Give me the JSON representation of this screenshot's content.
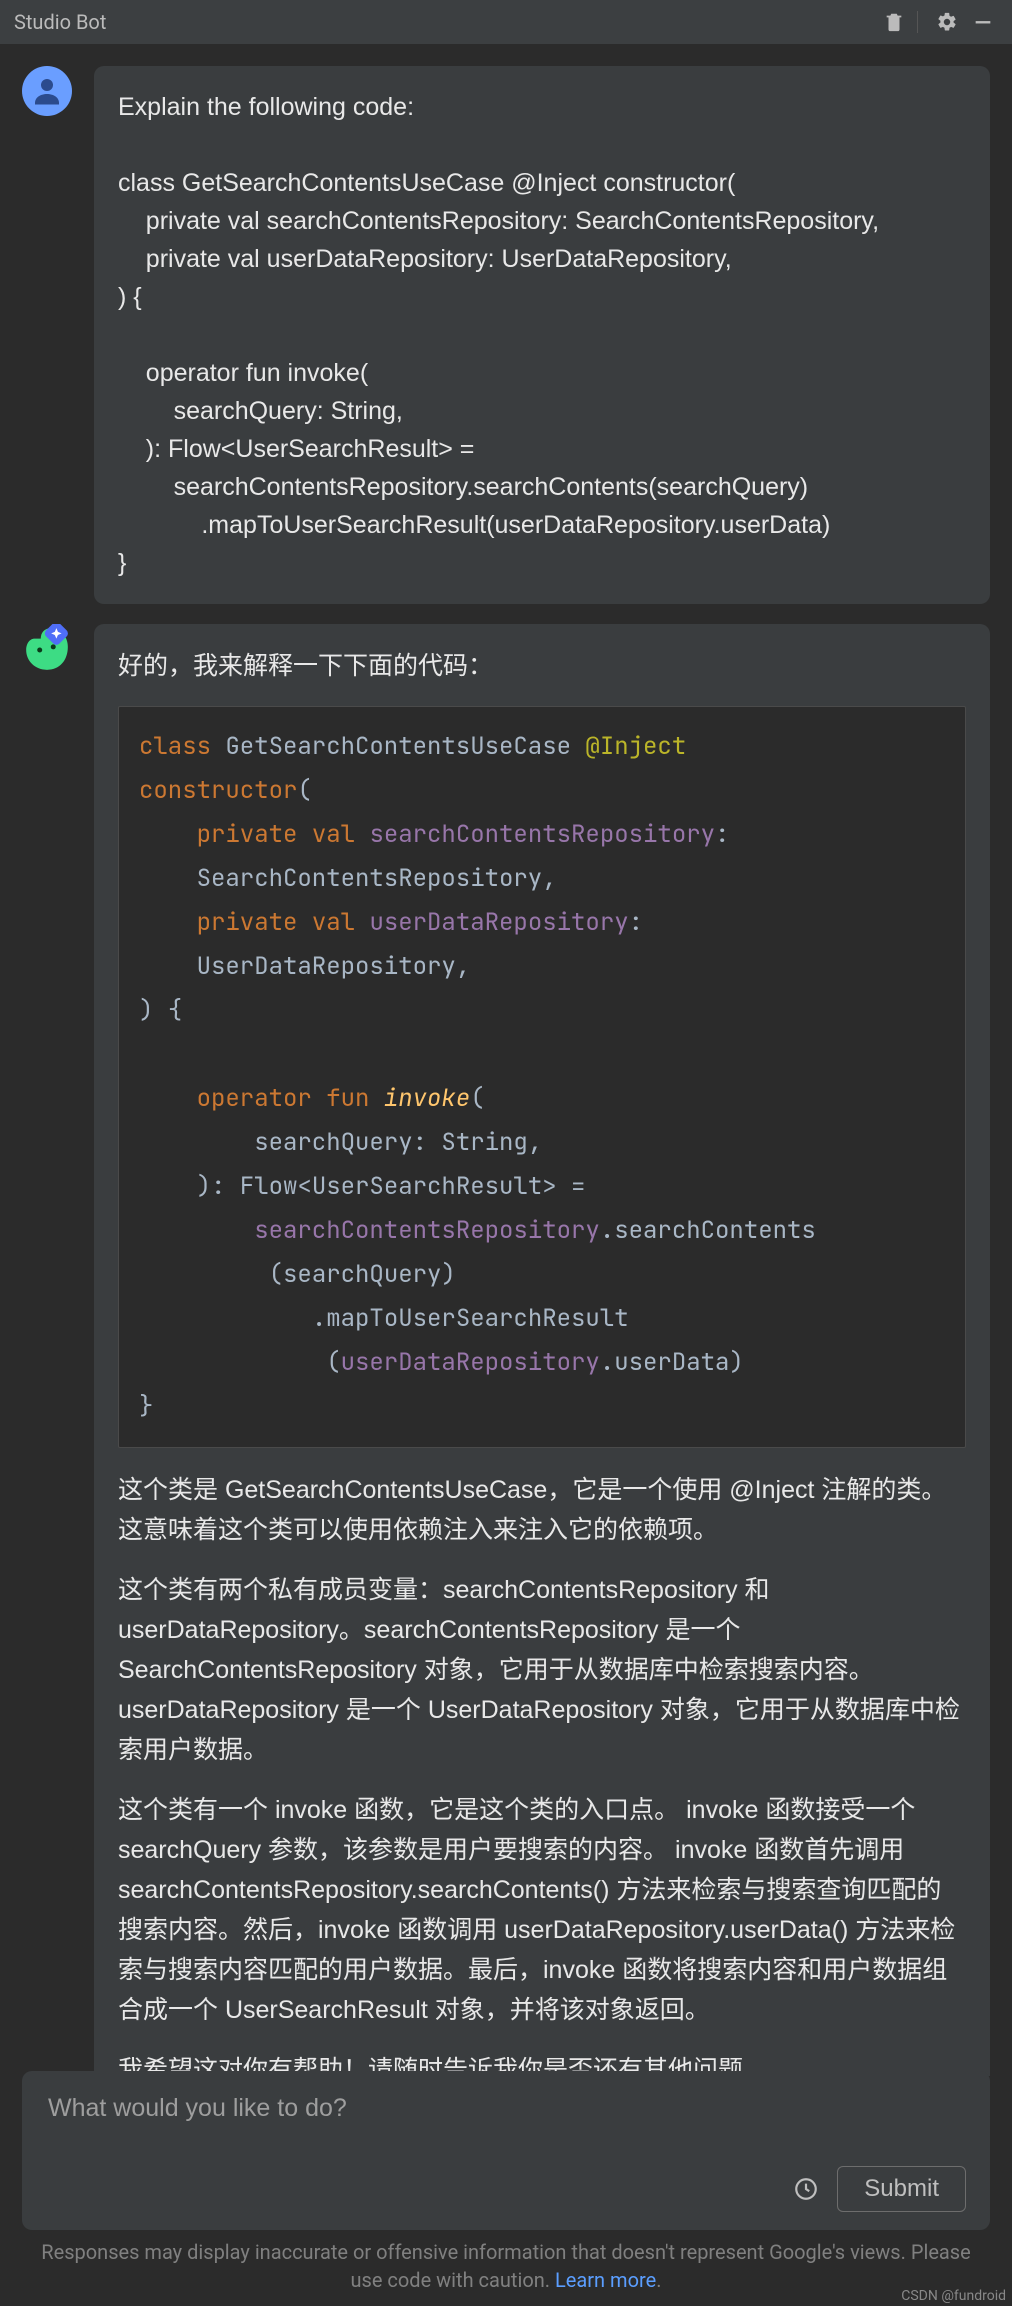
{
  "window": {
    "title": "Studio Bot"
  },
  "titlebar_icons": {
    "trash": "trash-icon",
    "gear": "gear-icon",
    "minimize": "minimize-icon"
  },
  "user_message": {
    "text": "Explain the following code:\n\nclass GetSearchContentsUseCase @Inject constructor(\n    private val searchContentsRepository: SearchContentsRepository,\n    private val userDataRepository: UserDataRepository,\n) {\n\n    operator fun invoke(\n        searchQuery: String,\n    ): Flow<UserSearchResult> =\n        searchContentsRepository.searchContents(searchQuery)\n            .mapToUserSearchResult(userDataRepository.userData)\n}"
  },
  "bot_message": {
    "intro": "好的，我来解释一下下面的代码：",
    "code_tokens": [
      {
        "t": "kw",
        "v": "class"
      },
      {
        "t": "sp",
        "v": " "
      },
      {
        "t": "type",
        "v": "GetSearchContentsUseCase"
      },
      {
        "t": "sp",
        "v": " "
      },
      {
        "t": "anno",
        "v": "@Inject"
      },
      {
        "t": "nl",
        "v": "\n"
      },
      {
        "t": "kw",
        "v": "constructor"
      },
      {
        "t": "punc",
        "v": "("
      },
      {
        "t": "nl",
        "v": "\n"
      },
      {
        "t": "sp",
        "v": "    "
      },
      {
        "t": "kw",
        "v": "private"
      },
      {
        "t": "sp",
        "v": " "
      },
      {
        "t": "kw",
        "v": "val"
      },
      {
        "t": "sp",
        "v": " "
      },
      {
        "t": "name",
        "v": "searchContentsRepository"
      },
      {
        "t": "punc",
        "v": ":"
      },
      {
        "t": "nl",
        "v": "\n"
      },
      {
        "t": "sp",
        "v": "    "
      },
      {
        "t": "type",
        "v": "SearchContentsRepository"
      },
      {
        "t": "punc",
        "v": ","
      },
      {
        "t": "nl",
        "v": "\n"
      },
      {
        "t": "sp",
        "v": "    "
      },
      {
        "t": "kw",
        "v": "private"
      },
      {
        "t": "sp",
        "v": " "
      },
      {
        "t": "kw",
        "v": "val"
      },
      {
        "t": "sp",
        "v": " "
      },
      {
        "t": "name",
        "v": "userDataRepository"
      },
      {
        "t": "punc",
        "v": ":"
      },
      {
        "t": "nl",
        "v": "\n"
      },
      {
        "t": "sp",
        "v": "    "
      },
      {
        "t": "type",
        "v": "UserDataRepository"
      },
      {
        "t": "punc",
        "v": ","
      },
      {
        "t": "nl",
        "v": "\n"
      },
      {
        "t": "punc",
        "v": ")"
      },
      {
        "t": "sp",
        "v": " "
      },
      {
        "t": "punc",
        "v": "{"
      },
      {
        "t": "nl",
        "v": "\n\n"
      },
      {
        "t": "sp",
        "v": "    "
      },
      {
        "t": "kw",
        "v": "operator"
      },
      {
        "t": "sp",
        "v": " "
      },
      {
        "t": "kw",
        "v": "fun"
      },
      {
        "t": "sp",
        "v": " "
      },
      {
        "t": "func",
        "v": "invoke"
      },
      {
        "t": "punc",
        "v": "("
      },
      {
        "t": "nl",
        "v": "\n"
      },
      {
        "t": "sp",
        "v": "        "
      },
      {
        "t": "type",
        "v": "searchQuery"
      },
      {
        "t": "punc",
        "v": ": "
      },
      {
        "t": "type",
        "v": "String"
      },
      {
        "t": "punc",
        "v": ","
      },
      {
        "t": "nl",
        "v": "\n"
      },
      {
        "t": "sp",
        "v": "    "
      },
      {
        "t": "punc",
        "v": "):"
      },
      {
        "t": "sp",
        "v": " "
      },
      {
        "t": "type",
        "v": "Flow<UserSearchResult> ="
      },
      {
        "t": "nl",
        "v": "\n"
      },
      {
        "t": "sp",
        "v": "        "
      },
      {
        "t": "name",
        "v": "searchContentsRepository"
      },
      {
        "t": "punc",
        "v": "."
      },
      {
        "t": "type",
        "v": "searchContents"
      },
      {
        "t": "nl",
        "v": "\n"
      },
      {
        "t": "sp",
        "v": "         "
      },
      {
        "t": "punc",
        "v": "("
      },
      {
        "t": "type",
        "v": "searchQuery"
      },
      {
        "t": "punc",
        "v": ")"
      },
      {
        "t": "nl",
        "v": "\n"
      },
      {
        "t": "sp",
        "v": "            "
      },
      {
        "t": "punc",
        "v": "."
      },
      {
        "t": "type",
        "v": "mapToUserSearchResult"
      },
      {
        "t": "nl",
        "v": "\n"
      },
      {
        "t": "sp",
        "v": "             "
      },
      {
        "t": "punc",
        "v": "("
      },
      {
        "t": "name",
        "v": "userDataRepository"
      },
      {
        "t": "punc",
        "v": "."
      },
      {
        "t": "type",
        "v": "userData"
      },
      {
        "t": "punc",
        "v": ")"
      },
      {
        "t": "nl",
        "v": "\n"
      },
      {
        "t": "punc",
        "v": "}"
      }
    ],
    "para1": "这个类是 GetSearchContentsUseCase，它是一个使用 @Inject 注解的类。这意味着这个类可以使用依赖注入来注入它的依赖项。",
    "para2": "这个类有两个私有成员变量：searchContentsRepository 和 userDataRepository。searchContentsRepository 是一个 SearchContentsRepository 对象，它用于从数据库中检索搜索内容。userDataRepository 是一个 UserDataRepository 对象，它用于从数据库中检索用户数据。",
    "para3": "这个类有一个 invoke 函数，它是这个类的入口点。 invoke 函数接受一个 searchQuery 参数，该参数是用户要搜索的内容。 invoke 函数首先调用 searchContentsRepository.searchContents() 方法来检索与搜索查询匹配的搜索内容。然后，invoke 函数调用 userDataRepository.userData() 方法来检索与搜索内容匹配的用户数据。最后，invoke 函数将搜索内容和用户数据组合成一个 UserSearchResult 对象，并将该对象返回。",
    "para4": "我希望这对你有帮助！请随时告诉我你是否还有其他问题。"
  },
  "feedback": {
    "thumbs_up": "thumb-up-icon",
    "thumbs_down": "thumb-down-icon"
  },
  "input": {
    "placeholder": "What would you like to do?",
    "submit_label": "Submit"
  },
  "footer": {
    "text_prefix": "Responses may display inaccurate or offensive information that doesn't represent Google's views. Please use code with caution. ",
    "link_text": "Learn more",
    "suffix": "."
  },
  "watermark": "CSDN @fundroid"
}
